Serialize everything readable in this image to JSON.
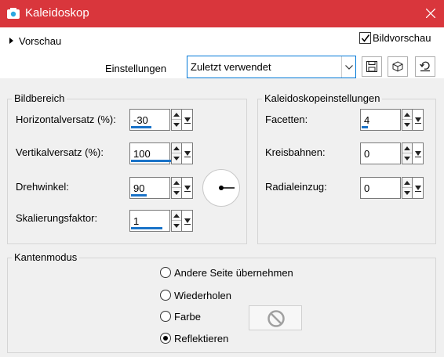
{
  "window": {
    "title": "Kaleidoskop"
  },
  "topbar": {
    "preview_toggle": "Vorschau",
    "bildvorschau": {
      "label": "Bildvorschau",
      "checked": true
    },
    "settings_label": "Einstellungen",
    "preset_value": "Zuletzt verwendet"
  },
  "bildbereich": {
    "title": "Bildbereich",
    "horizontal": {
      "label": "Horizontalversatz (%):",
      "value": "-30"
    },
    "vertikal": {
      "label": "Vertikalversatz (%):",
      "value": "100"
    },
    "drehwinkel": {
      "label": "Drehwinkel:",
      "value": "90"
    },
    "skalierung": {
      "label": "Skalierungsfaktor:",
      "value": "1"
    }
  },
  "kaleido": {
    "title": "Kaleidoskopeinstellungen",
    "facetten": {
      "label": "Facetten:",
      "value": "4"
    },
    "kreisbahnen": {
      "label": "Kreisbahnen:",
      "value": "0"
    },
    "radialeinzug": {
      "label": "Radialeinzug:",
      "value": "0"
    }
  },
  "kantenmodus": {
    "title": "Kantenmodus",
    "options": [
      {
        "label": "Andere Seite übernehmen",
        "selected": false
      },
      {
        "label": "Wiederholen",
        "selected": false
      },
      {
        "label": "Farbe",
        "selected": false
      },
      {
        "label": "Reflektieren",
        "selected": true
      }
    ]
  },
  "colors": {
    "titlebar": "#d9363c",
    "accent": "#0078d7",
    "slider": "#1a73c8"
  },
  "icons": [
    "camera-icon",
    "close-icon",
    "save-preset-icon",
    "preset-manager-icon",
    "reset-icon",
    "no-color-icon"
  ]
}
